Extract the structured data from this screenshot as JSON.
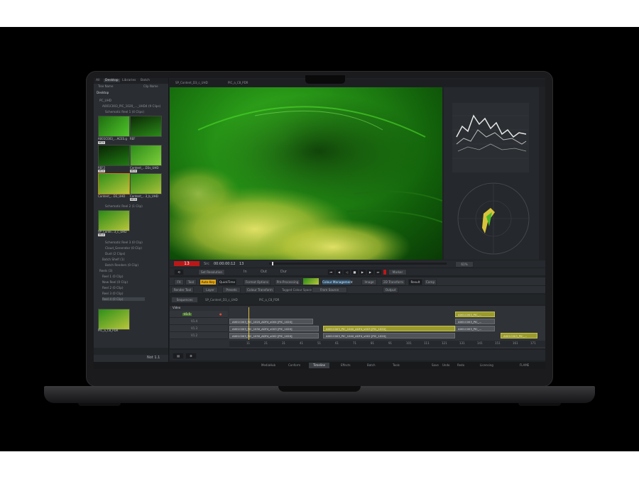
{
  "library": {
    "tabs": [
      "All",
      "Desktop",
      "Libraries",
      "Batch"
    ],
    "columns": [
      "Tree Name",
      "Clip Name"
    ],
    "tree": [
      "Desktop",
      "PC_UHD",
      "A001C003_PIC_1020_..._UHD4 (9 Clips)",
      "Schematic Reel 1 (4 Clips)",
      "Schematic Reel 2 (1 Clip)",
      "Schematic Reel 3 (0 Clip)",
      "Cloud_Generator (0 Clip)",
      "Dust (2 Clips)",
      "Batch Shelf (1)",
      "Batch Renders (0 Clip)",
      "Reels (3)",
      "Reel 1 (0 Clip)",
      "New Reel (0 Clip)",
      "Reel 2 (0 Clip)",
      "Reel 3 (0 Clip)",
      "Reel 4 (0 Clip)"
    ],
    "thumbs": [
      {
        "label": "A001C003_...ACES.g",
        "badge": "MOV"
      },
      {
        "label": "REF",
        "badge": ""
      },
      {
        "label": "REF2",
        "badge": "MOV"
      },
      {
        "label": "Content_...D3s_UHD",
        "badge": "MOV"
      },
      {
        "label": "Content_...D3_UHD",
        "badge": ""
      },
      {
        "label": "Content_...3_b_UHD",
        "badge": "MOV"
      },
      {
        "label": "SP_Conte...3_c_UHD",
        "badge": "MOV"
      },
      {
        "label": "PIC_a_C8_PDR",
        "badge": ""
      }
    ],
    "footer_value": "Not 1.1"
  },
  "viewer_tabs": [
    "SP_Content_D3_c_UHD",
    "PIC_a_C8_PDR"
  ],
  "transport": {
    "timecode": "13",
    "src_label": "Src",
    "src_tc": "00:00:00:12",
    "frame": "13",
    "in_label": "In",
    "out_label": "Out",
    "dur_label": "Dur",
    "set_resolution": "Set Resolution",
    "marker": "Marker",
    "zoom": "61%"
  },
  "format_row": {
    "buttons": [
      "FX",
      "Tool",
      "Auto Key",
      "QuickTime",
      "Format Options",
      "Pre-Processing",
      "Colour Management",
      "Image",
      "2D Transform",
      "Result",
      "Comp"
    ],
    "presets": [
      "Render Tool",
      "Layer",
      "Presets",
      "Colour Transform",
      "Tagged Colour Space",
      "From Source",
      "Output"
    ]
  },
  "timeline": {
    "sequences_label": "Sequences",
    "tabs": [
      "SP_Content_D3_c_UHD",
      "PIC_a_C8_PDR"
    ],
    "video_label": "Video",
    "tracks": [
      "V1.5",
      "V1.4",
      "V1.3",
      "V1.2"
    ],
    "clips": [
      "A001C003_PIC_1020_ADF4_v004 [PIC_1020]",
      "A001C003_PIC_1030_ADF4_v003 [PIC_1020]",
      "A001C003_PIC_1040_ADF4_v003 [PIC_1020]",
      "A001C003_PIC_1030_ADF4_v002 [PIC_1020]",
      "A001C003_PIC_1040_ADF4_v002 [PIC_1020]",
      "A001C003_PIC_...",
      "A001C003_PIC_...",
      "A001C003_PIC_...",
      "A001C003_PIC_..."
    ],
    "ruler": [
      "11",
      "21",
      "31",
      "41",
      "51",
      "61",
      "71",
      "81",
      "91",
      "101",
      "111",
      "121",
      "131",
      "141",
      "151",
      "161",
      "171"
    ]
  },
  "bottom_tabs": [
    "MediaHub",
    "Conform",
    "Timeline",
    "Effects",
    "Batch",
    "Tools"
  ],
  "status": [
    "Save",
    "Undo",
    "Redo",
    "Licensing",
    "FLAME"
  ]
}
